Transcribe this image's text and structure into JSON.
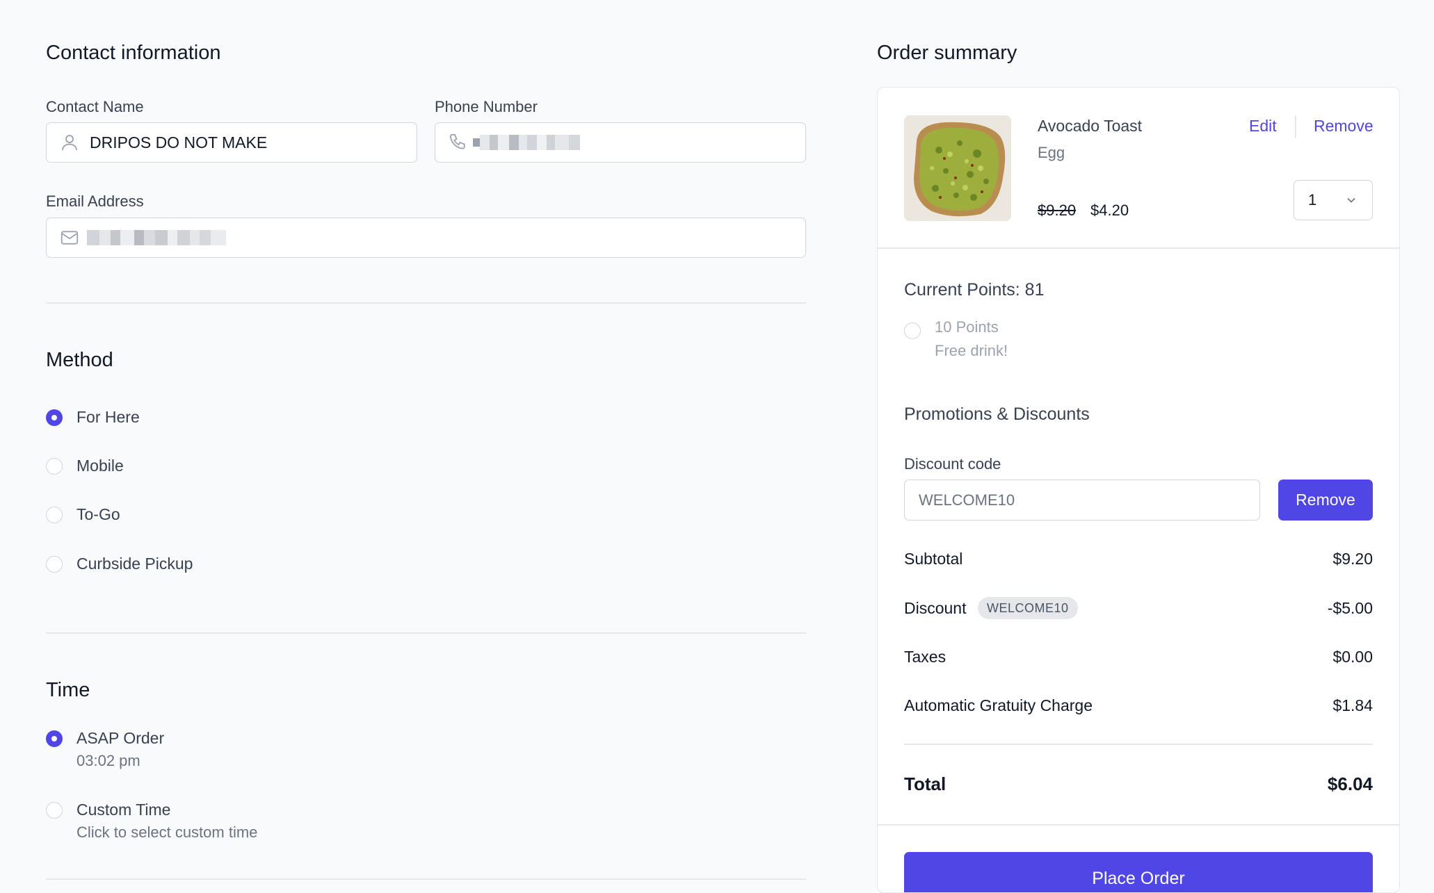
{
  "contact": {
    "title": "Contact information",
    "name_label": "Contact Name",
    "name_value": "DRIPOS DO NOT MAKE",
    "phone_label": "Phone Number",
    "email_label": "Email Address"
  },
  "method": {
    "title": "Method",
    "options": [
      {
        "label": "For Here",
        "selected": true
      },
      {
        "label": "Mobile",
        "selected": false
      },
      {
        "label": "To-Go",
        "selected": false
      },
      {
        "label": "Curbside Pickup",
        "selected": false
      }
    ]
  },
  "time": {
    "title": "Time",
    "options": [
      {
        "label": "ASAP Order",
        "sub": "03:02 pm",
        "selected": true
      },
      {
        "label": "Custom Time",
        "sub": "Click to select custom time",
        "selected": false
      }
    ]
  },
  "summary": {
    "title": "Order summary",
    "item": {
      "name": "Avocado Toast",
      "modifier": "Egg",
      "edit_label": "Edit",
      "remove_label": "Remove",
      "original_price": "$9.20",
      "price": "$4.20",
      "quantity": "1"
    },
    "points": {
      "title": "Current Points: 81",
      "reward_points": "10 Points",
      "reward_desc": "Free drink!"
    },
    "promotions": {
      "title": "Promotions & Discounts",
      "code_label": "Discount code",
      "code_value": "WELCOME10",
      "remove_label": "Remove"
    },
    "totals": {
      "subtotal_label": "Subtotal",
      "subtotal_value": "$9.20",
      "discount_label": "Discount",
      "discount_badge": "WELCOME10",
      "discount_value": "-$5.00",
      "taxes_label": "Taxes",
      "taxes_value": "$0.00",
      "gratuity_label": "Automatic Gratuity Charge",
      "gratuity_value": "$1.84",
      "total_label": "Total",
      "total_value": "$6.04"
    },
    "place_order_label": "Place Order"
  },
  "colors": {
    "accent": "#4f46e5",
    "background": "#f9fafb"
  }
}
